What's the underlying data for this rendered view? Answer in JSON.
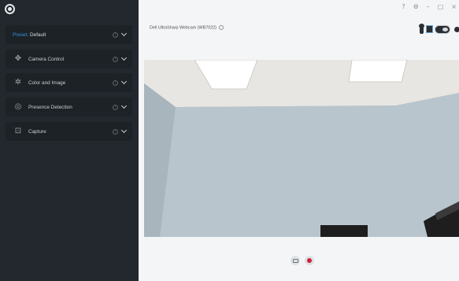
{
  "app": {
    "logo_icon": "webcam-logo-icon"
  },
  "window_controls": {
    "help": "?",
    "settings": "⚙",
    "minimize": "–",
    "maximize": "□",
    "close": "×"
  },
  "sidebar": {
    "preset": {
      "key_label": "Preset:",
      "value": "Default"
    },
    "items": [
      {
        "label": "Camera Control",
        "icon": "camera-control-icon"
      },
      {
        "label": "Color and Image",
        "icon": "color-image-icon"
      },
      {
        "label": "Presence Detection",
        "icon": "presence-detection-icon"
      },
      {
        "label": "Capture",
        "icon": "capture-icon"
      }
    ],
    "info_glyph": "i"
  },
  "main": {
    "device_name": "Dell UltraSharp Webcam (WB7022)",
    "preview_description": "room ceiling with two lights and blue wall"
  },
  "colors": {
    "sidebar_bg": "#22282d",
    "panel_bg": "#1c2226",
    "accent_blue": "#3a8fd8",
    "record_red": "#d3203a"
  }
}
